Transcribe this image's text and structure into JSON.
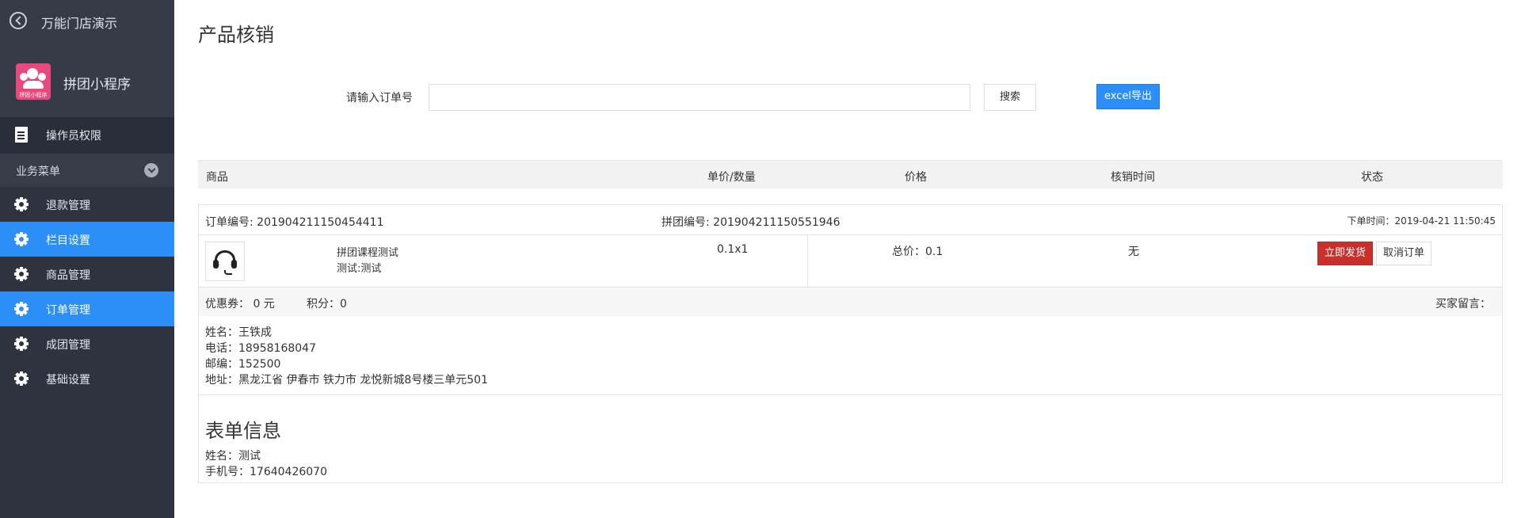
{
  "sidebar": {
    "back_label": "万能门店演示",
    "app_name": "拼团小程序",
    "app_logo_caption": "拼团小程序",
    "permission_label": "操作员权限",
    "section_label": "业务菜单",
    "items": [
      {
        "label": "退款管理",
        "active": false
      },
      {
        "label": "栏目设置",
        "active": true
      },
      {
        "label": "商品管理",
        "active": false
      },
      {
        "label": "订单管理",
        "active": true
      },
      {
        "label": "成团管理",
        "active": false
      },
      {
        "label": "基础设置",
        "active": false
      }
    ]
  },
  "page": {
    "title": "产品核销"
  },
  "search": {
    "label": "请输入订单号",
    "value": "",
    "placeholder": "",
    "search_button": "搜索",
    "export_button": "excel导出"
  },
  "table_headers": [
    "商品",
    "单价/数量",
    "价格",
    "核销时间",
    "状态"
  ],
  "order": {
    "order_no": "订单编号: 201904211150454411",
    "group_no": "拼团编号: 201904211150551946",
    "order_time": "下单时间：2019-04-21 11:50:45",
    "product_icon": "headset-icon",
    "product_name": "拼团课程测试",
    "product_spec": "测试:测试",
    "unit_qty": "0.1x1",
    "total": "总价：0.1",
    "verify_time": "无",
    "ship_button": "立即发货",
    "cancel_button": "取消订单",
    "coupon": "优惠券： 0 元",
    "points": "积分：0",
    "buyer_note": "买家留言：",
    "name": "姓名：王铁成",
    "phone": "电话：18958168047",
    "zip": "邮编：152500",
    "address": "地址：黑龙江省 伊春市 铁力市 龙悦新城8号楼三单元501"
  },
  "form_info": {
    "title": "表单信息",
    "name": "姓名：测试",
    "mobile": "手机号：17640426070"
  },
  "colors": {
    "sidebar_bg": "#2f3340",
    "accent_blue": "#2c8ff7",
    "ship_red": "#c9302c"
  }
}
